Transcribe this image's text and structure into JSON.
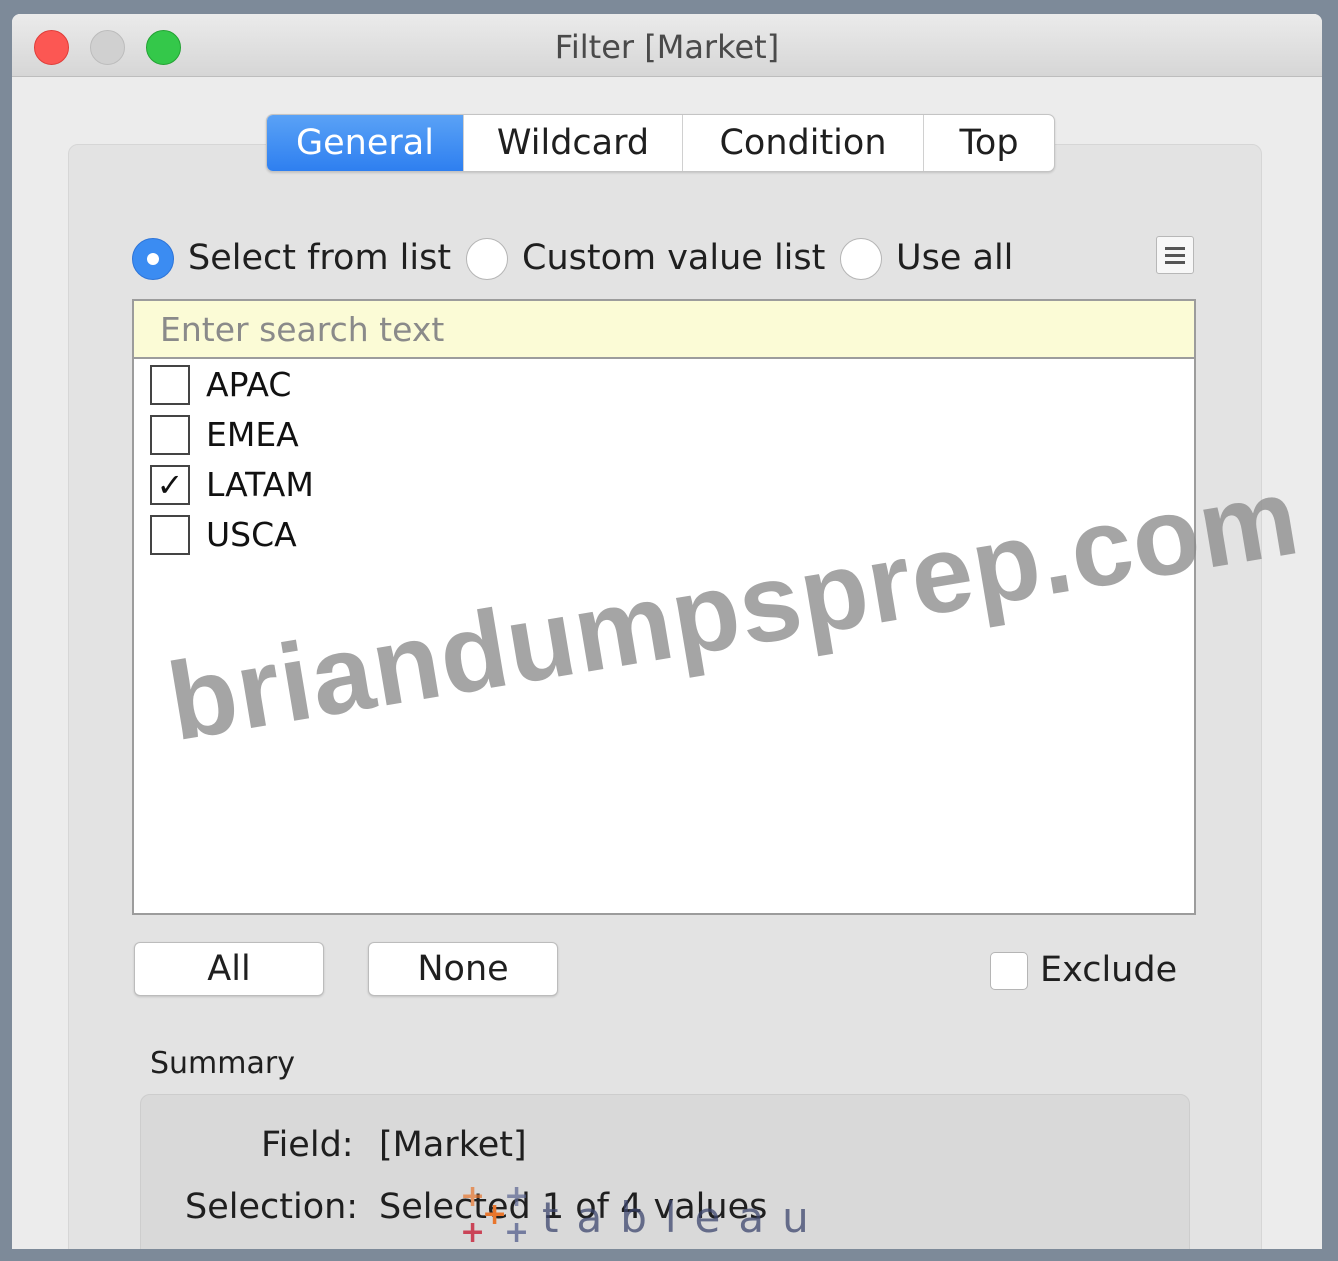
{
  "window": {
    "title": "Filter [Market]"
  },
  "tabs": [
    {
      "label": "General",
      "active": true
    },
    {
      "label": "Wildcard",
      "active": false
    },
    {
      "label": "Condition",
      "active": false
    },
    {
      "label": "Top",
      "active": false
    }
  ],
  "mode": {
    "options": [
      {
        "label": "Select from list",
        "checked": true
      },
      {
        "label": "Custom value list",
        "checked": false
      },
      {
        "label": "Use all",
        "checked": false
      }
    ]
  },
  "menu_button_icon": "hamburger-menu-icon",
  "search": {
    "placeholder": "Enter search text",
    "value": ""
  },
  "values": [
    {
      "label": "APAC",
      "checked": false
    },
    {
      "label": "EMEA",
      "checked": false
    },
    {
      "label": "LATAM",
      "checked": true
    },
    {
      "label": "USCA",
      "checked": false
    }
  ],
  "checkmark_glyph": "✓",
  "buttons": {
    "all": "All",
    "none": "None"
  },
  "exclude": {
    "label": "Exclude",
    "checked": false
  },
  "summary": {
    "heading": "Summary",
    "field_key": "Field:",
    "field_value": "[Market]",
    "selection_key": "Selection:",
    "selection_value": "Selected 1 of 4 values"
  },
  "watermark": "briandumpsprep.com",
  "logo": {
    "wordmark": "tableau"
  },
  "colors": {
    "accent": "#3b8cf2",
    "close": "#fc5753",
    "maximize": "#34c84a",
    "search_bg": "#fbfbd6"
  }
}
